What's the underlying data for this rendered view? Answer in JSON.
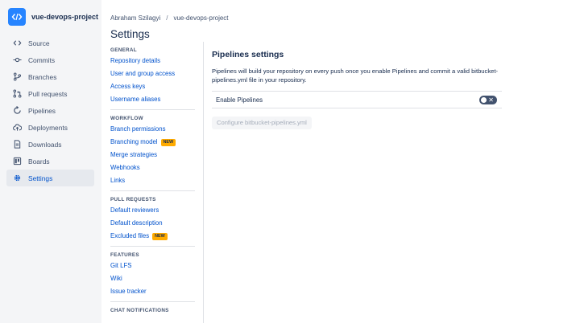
{
  "repo": {
    "name": "vue-devops-project"
  },
  "nav": {
    "items": [
      {
        "label": "Source",
        "icon": "code-icon"
      },
      {
        "label": "Commits",
        "icon": "commit-icon"
      },
      {
        "label": "Branches",
        "icon": "branch-icon"
      },
      {
        "label": "Pull requests",
        "icon": "pull-request-icon"
      },
      {
        "label": "Pipelines",
        "icon": "pipelines-icon"
      },
      {
        "label": "Deployments",
        "icon": "cloud-upload-icon"
      },
      {
        "label": "Downloads",
        "icon": "document-icon"
      },
      {
        "label": "Boards",
        "icon": "board-icon"
      },
      {
        "label": "Settings",
        "icon": "gear-icon",
        "active": true
      }
    ]
  },
  "breadcrumb": {
    "owner": "Abraham Szilagyi",
    "separator": "/",
    "repo": "vue-devops-project"
  },
  "page_title": "Settings",
  "settings_menu": {
    "general": {
      "heading": "GENERAL",
      "links": [
        "Repository details",
        "User and group access",
        "Access keys",
        "Username aliases"
      ]
    },
    "workflow": {
      "heading": "WORKFLOW",
      "links": [
        "Branch permissions",
        "Branching model",
        "Merge strategies",
        "Webhooks",
        "Links"
      ],
      "badge": "NEW"
    },
    "pull_requests": {
      "heading": "PULL REQUESTS",
      "links": [
        "Default reviewers",
        "Default description",
        "Excluded files"
      ],
      "badge": "NEW"
    },
    "features": {
      "heading": "FEATURES",
      "links": [
        "Git LFS",
        "Wiki",
        "Issue tracker"
      ]
    },
    "chat": {
      "heading": "CHAT NOTIFICATIONS"
    }
  },
  "pipelines": {
    "title": "Pipelines settings",
    "description": "Pipelines will build your repository on every push once you enable Pipelines and commit a valid bitbucket-pipelines.yml file in your repository.",
    "enable_label": "Enable Pipelines",
    "enabled": false,
    "configure_button": "Configure bitbucket-pipelines.yml"
  },
  "colors": {
    "accent": "#0052cc",
    "sidebar_bg": "#f4f5f7",
    "badge": "#ffab00",
    "repo_avatar": "#2684ff"
  }
}
